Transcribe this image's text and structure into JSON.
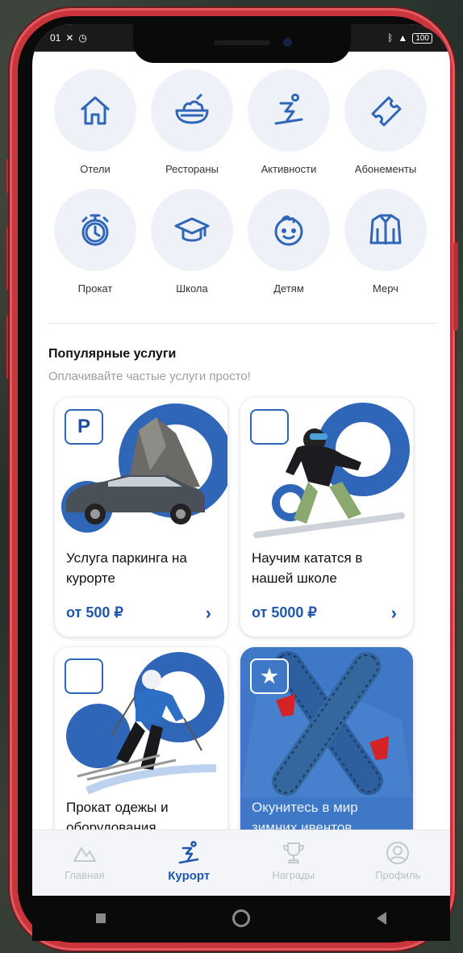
{
  "status_bar": {
    "time": "01",
    "battery": "100"
  },
  "categories": [
    {
      "label": "Отели",
      "icon": "house-icon"
    },
    {
      "label": "Рестораны",
      "icon": "food-bowl-icon"
    },
    {
      "label": "Активности",
      "icon": "skier-icon"
    },
    {
      "label": "Абонементы",
      "icon": "ticket-icon"
    },
    {
      "label": "Прокат",
      "icon": "stopwatch-icon"
    },
    {
      "label": "Школа",
      "icon": "graduation-cap-icon"
    },
    {
      "label": "Детям",
      "icon": "child-face-icon"
    },
    {
      "label": "Мерч",
      "icon": "jacket-icon"
    }
  ],
  "popular": {
    "title": "Популярные услуги",
    "subtitle": "Оплачивайте частые услуги просто!"
  },
  "cards": [
    {
      "badge": "P",
      "title": "Услуга паркинга на курорте",
      "price": "от 500 ₽",
      "arrow": "›"
    },
    {
      "badge": "",
      "title": "Научим кататся в нашей школе",
      "price": "от 5000 ₽",
      "arrow": "›"
    },
    {
      "badge": "",
      "title": "Прокат одежы и оборудования",
      "price": "",
      "arrow": ""
    },
    {
      "badge": "★",
      "title": "Окунитесь в мир зимних ивентов",
      "price": "",
      "arrow": ""
    }
  ],
  "tabbar": [
    {
      "label": "Главная",
      "icon": "mountain-icon",
      "active": false
    },
    {
      "label": "Курорт",
      "icon": "skier-icon",
      "active": true
    },
    {
      "label": "Награды",
      "icon": "trophy-icon",
      "active": false
    },
    {
      "label": "Профиль",
      "icon": "profile-icon",
      "active": false
    }
  ],
  "colors": {
    "accent": "#1f57b0",
    "frame": "#c9353b",
    "circle_bg": "#eef2f8",
    "card_blue": "#3f78c6"
  }
}
